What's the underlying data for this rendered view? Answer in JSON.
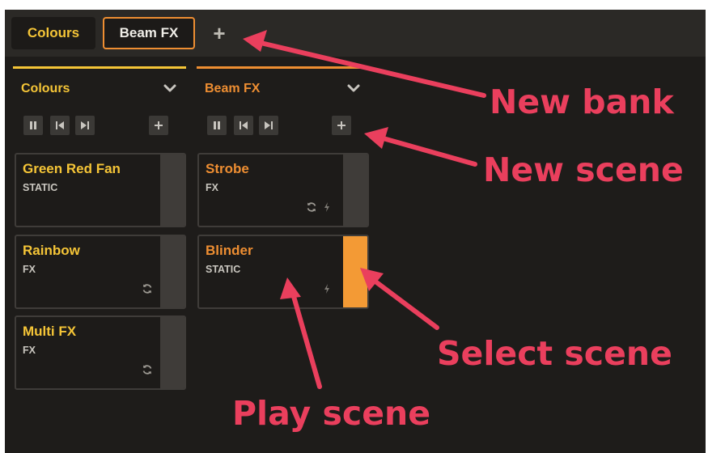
{
  "tabs": [
    {
      "label": "Colours"
    },
    {
      "label": "Beam FX"
    }
  ],
  "add_tab_label": "+",
  "columns": [
    {
      "title": "Colours",
      "scenes": [
        {
          "name": "Green Red Fan",
          "type": "STATIC"
        },
        {
          "name": "Rainbow",
          "type": "FX"
        },
        {
          "name": "Multi FX",
          "type": "FX"
        }
      ]
    },
    {
      "title": "Beam FX",
      "scenes": [
        {
          "name": "Strobe",
          "type": "FX"
        },
        {
          "name": "Blinder",
          "type": "STATIC"
        }
      ]
    }
  ],
  "annotations": {
    "new_bank": "New bank",
    "new_scene": "New scene",
    "select_scene": "Select scene",
    "play_scene": "Play scene"
  },
  "colors": {
    "background": "#1e1c1a",
    "colours_accent": "#f5c537",
    "beam_accent": "#ee8e32",
    "selected_strip": "#f39a35",
    "annotation": "#ea3f5d"
  },
  "icons": [
    "pause-icon",
    "skip-back-icon",
    "skip-forward-icon",
    "plus-icon",
    "chevron-down-icon",
    "loop-icon",
    "bolt-icon"
  ]
}
